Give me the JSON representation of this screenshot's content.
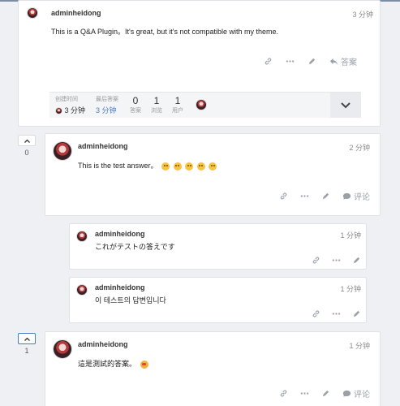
{
  "question": {
    "username": "adminheidong",
    "time": "3 分钟",
    "body": "This is a Q&A Plugin。It's great, but it's not compatible with my theme.",
    "answer_label": "答案",
    "meta": {
      "created_label": "创建时间",
      "created_value": "3 分钟",
      "last_answer_label": "最后答案",
      "last_answer_value": "3 分钟",
      "answers_count": "0",
      "answers_label": "答案",
      "views_count": "1",
      "views_label": "浏览",
      "users_count": "1",
      "users_label": "用户"
    }
  },
  "answers": [
    {
      "vote_count": "0",
      "username": "adminheidong",
      "time": "2 分钟",
      "body": "This is the test answer。",
      "comment_label": "评论"
    },
    {
      "vote_count": "1",
      "username": "adminheidong",
      "time": "1 分钟",
      "body": "這是測試的答案。",
      "comment_label": "评论"
    }
  ],
  "comments": [
    {
      "username": "adminheidong",
      "time": "1 分钟",
      "body": "これがテストの答えです"
    },
    {
      "username": "adminheidong",
      "time": "1 分钟",
      "body": "이 테스트의 답변입니다"
    }
  ],
  "colors": {
    "accent": "#4a7cc6",
    "muted": "#9aa0a6",
    "background": "#eef0f3"
  },
  "icons": [
    "link-icon",
    "more-icon",
    "edit-icon",
    "reply-icon",
    "chevron-down-icon",
    "chevron-up-icon",
    "comment-icon",
    "smile-emoji-icon",
    "love-emoji-icon"
  ]
}
